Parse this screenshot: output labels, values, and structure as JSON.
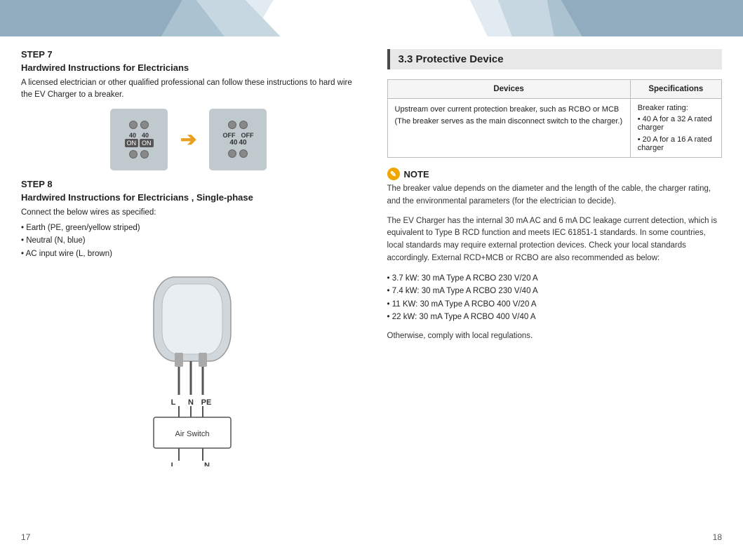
{
  "header": {
    "left_shape_color1": "#6b8fa8",
    "left_shape_color2": "#b0c8d8",
    "right_shape_color1": "#6b8fa8",
    "right_shape_color2": "#b0c8d8"
  },
  "left_page": {
    "step7_label": "STEP 7",
    "step7_title": "Hardwired Instructions for Electricians",
    "step7_body": "A licensed electrician or other qualified professional can follow these instructions to hard wire the EV Charger to a breaker.",
    "breaker_on_label1": "40",
    "breaker_on_label2": "40",
    "breaker_on_switch1": "ON",
    "breaker_on_switch2": "ON",
    "breaker_off_label1": "OFF",
    "breaker_off_label2": "OFF",
    "breaker_off_num1": "40",
    "breaker_off_num2": "40",
    "step8_label": "STEP 8",
    "step8_title": "Hardwired Instructions for Electricians , Single-phase",
    "step8_body": "Connect the below wires as specified:",
    "wires": [
      "Earth (PE, green/yellow striped)",
      "Neutral (N, blue)",
      "AC input wire (L, brown)"
    ],
    "wire_labels": [
      "L",
      "N",
      "PE"
    ],
    "air_switch_label": "Air Switch",
    "bottom_labels": [
      "L",
      "N"
    ],
    "page_number": "17"
  },
  "right_page": {
    "section_title": "3.3 Protective Device",
    "table": {
      "col1": "Devices",
      "col2": "Specifications",
      "row1_device": "Upstream over current protection breaker, such as RCBO or MCB (The breaker serves as the main disconnect switch to the charger.)",
      "row1_spec_label": "Breaker rating:",
      "row1_spec1": "40 A for a 32 A rated charger",
      "row1_spec2": "20 A for a 16 A rated charger"
    },
    "note_title": "NOTE",
    "note_body1": "The breaker value depends on the diameter and the length of the cable, the charger rating, and the environmental parameters (for the electrician to decide).",
    "note_body2": "The EV Charger has the internal 30 mA AC and 6 mA DC leakage current detection, which is equivalent to Type B RCD function and meets IEC 61851-1 standards. In some countries, local standards may require external protection devices. Check your local standards accordingly. External RCD+MCB or RCBO are also recommended as below:",
    "rcbo_list": [
      "3.7 kW: 30 mA Type A RCBO 230 V/20 A",
      "7.4 kW: 30 mA Type A RCBO 230 V/40 A",
      "11 KW: 30 mA Type A RCBO 400 V/20 A",
      "22 kW: 30 mA Type A RCBO 400 V/40 A"
    ],
    "note_footer": "Otherwise, comply with local regulations.",
    "page_number": "18"
  }
}
